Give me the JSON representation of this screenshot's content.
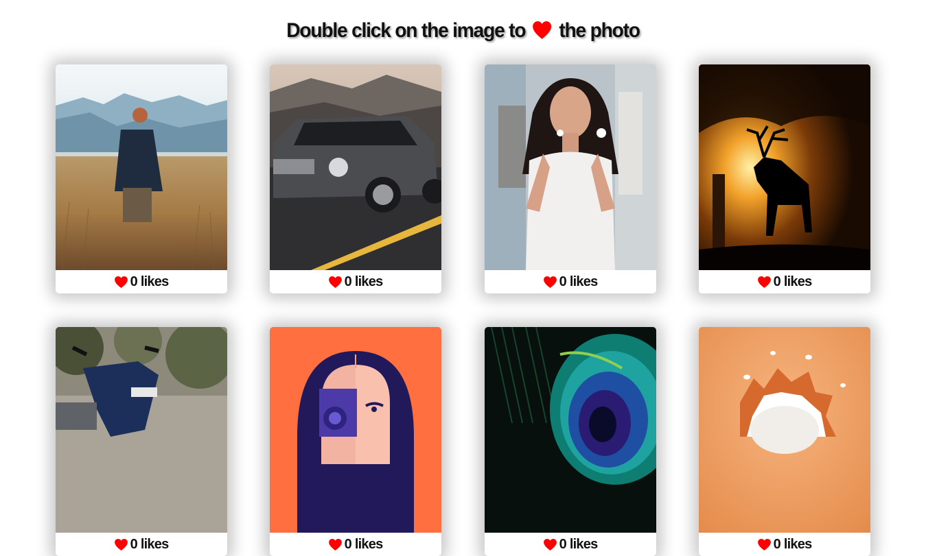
{
  "header": {
    "prefix": "Double click on the image to",
    "suffix": "the photo",
    "heart_icon": "heart-icon"
  },
  "colors": {
    "heart": "#ff0000",
    "text": "#111111"
  },
  "cards": [
    {
      "subject": "hiker-in-field",
      "likes": "0",
      "likes_label": "likes"
    },
    {
      "subject": "vintage-car",
      "likes": "0",
      "likes_label": "likes"
    },
    {
      "subject": "woman-white-dress",
      "likes": "0",
      "likes_label": "likes"
    },
    {
      "subject": "deer-silhouette-sunset",
      "likes": "0",
      "likes_label": "likes"
    },
    {
      "subject": "scooter",
      "likes": "0",
      "likes_label": "likes"
    },
    {
      "subject": "camera-illustration",
      "likes": "0",
      "likes_label": "likes"
    },
    {
      "subject": "peacock-feather",
      "likes": "0",
      "likes_label": "likes"
    },
    {
      "subject": "torn-paper-orange",
      "likes": "0",
      "likes_label": "likes"
    }
  ]
}
